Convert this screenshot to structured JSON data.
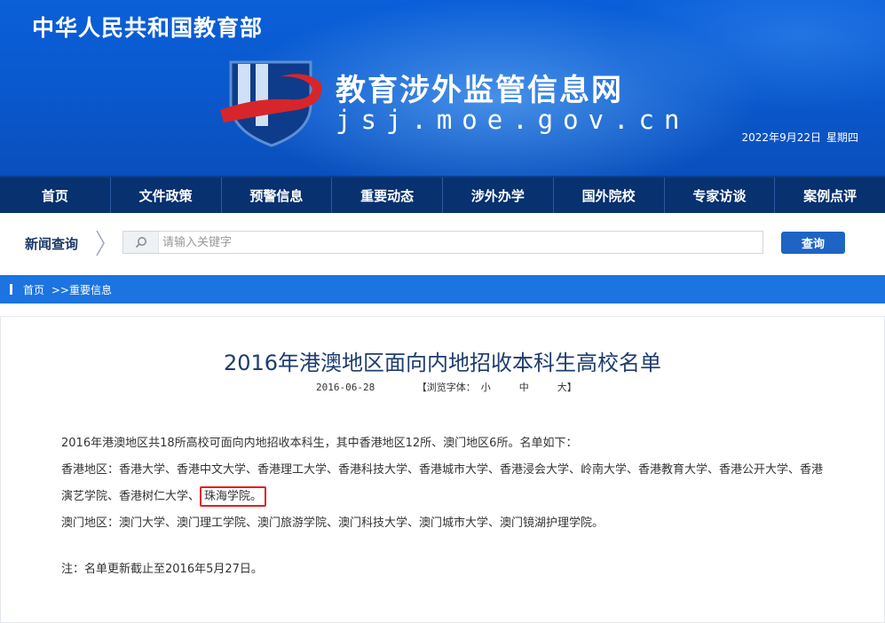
{
  "header": {
    "ministry": "中华人民共和国教育部",
    "site_title": "教育涉外监管信息网",
    "site_domain": "jsj.moe.gov.cn",
    "date": "2022年9月22日",
    "weekday": "星期四",
    "logo_icon": "js-logo-icon"
  },
  "nav": {
    "items": [
      {
        "label": "首页"
      },
      {
        "label": "文件政策"
      },
      {
        "label": "预警信息"
      },
      {
        "label": "重要动态"
      },
      {
        "label": "涉外办学"
      },
      {
        "label": "国外院校"
      },
      {
        "label": "专家访谈"
      },
      {
        "label": "案例点评"
      }
    ]
  },
  "search": {
    "label": "新闻查询",
    "placeholder": "请输入关键字",
    "button": "查询"
  },
  "breadcrumb": {
    "home": "首页",
    "separator": ">>",
    "current": "重要信息"
  },
  "article": {
    "title": "2016年港澳地区面向内地招收本科生高校名单",
    "date": "2016-06-28",
    "font_label_open": "【浏览字体：",
    "font_small": "小",
    "font_medium": "中",
    "font_large": "大",
    "font_label_close": "】",
    "intro": "2016年港澳地区共18所高校可面向内地招收本科生，其中香港地区12所、澳门地区6所。名单如下：",
    "hk_prefix": "香港地区：香港大学、香港中文大学、香港理工大学、香港科技大学、香港城市大学、香港浸会大学、岭南大学、香港教育大学、香港公开大学、香港演艺学院、香港树仁大学、",
    "hk_highlight": "珠海学院。",
    "macau": "澳门地区：澳门大学、澳门理工学院、澳门旅游学院、澳门科技大学、澳门城市大学、澳门镜湖护理学院。",
    "note": "注：名单更新截止至2016年5月27日。"
  },
  "colors": {
    "banner": "#0a58cc",
    "nav": "#07316f",
    "crumbbar": "#1c74e0",
    "button": "#1d64c4",
    "highlight_border": "#e02020"
  }
}
